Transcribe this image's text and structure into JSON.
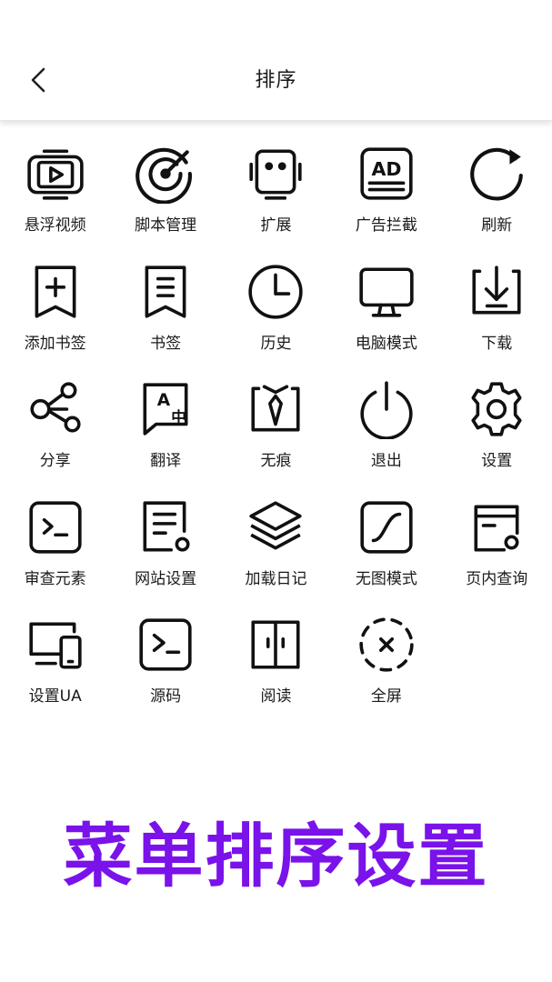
{
  "header": {
    "title": "排序",
    "back_icon": "chevron-left-icon"
  },
  "menu": {
    "items": [
      {
        "label": "悬浮视频",
        "icon": "floating-video-icon"
      },
      {
        "label": "脚本管理",
        "icon": "script-target-icon"
      },
      {
        "label": "扩展",
        "icon": "extension-robot-icon"
      },
      {
        "label": "广告拦截",
        "icon": "ad-block-icon"
      },
      {
        "label": "刷新",
        "icon": "refresh-icon"
      },
      {
        "label": "添加书签",
        "icon": "add-bookmark-icon"
      },
      {
        "label": "书签",
        "icon": "bookmark-icon"
      },
      {
        "label": "历史",
        "icon": "history-clock-icon"
      },
      {
        "label": "电脑模式",
        "icon": "desktop-mode-icon"
      },
      {
        "label": "下载",
        "icon": "download-icon"
      },
      {
        "label": "分享",
        "icon": "share-icon"
      },
      {
        "label": "翻译",
        "icon": "translate-icon"
      },
      {
        "label": "无痕",
        "icon": "incognito-icon"
      },
      {
        "label": "退出",
        "icon": "power-exit-icon"
      },
      {
        "label": "设置",
        "icon": "gear-icon"
      },
      {
        "label": "审查元素",
        "icon": "inspect-terminal-icon"
      },
      {
        "label": "网站设置",
        "icon": "site-settings-icon"
      },
      {
        "label": "加载日记",
        "icon": "layers-log-icon"
      },
      {
        "label": "无图模式",
        "icon": "no-image-icon"
      },
      {
        "label": "页内查询",
        "icon": "find-in-page-icon"
      },
      {
        "label": "设置UA",
        "icon": "user-agent-devices-icon"
      },
      {
        "label": "源码",
        "icon": "source-code-icon"
      },
      {
        "label": "阅读",
        "icon": "reader-icon"
      },
      {
        "label": "全屏",
        "icon": "fullscreen-icon"
      }
    ]
  },
  "promo": {
    "text": "菜单排序设置"
  },
  "colors": {
    "accent": "#7a12ea",
    "icon": "#111111"
  }
}
